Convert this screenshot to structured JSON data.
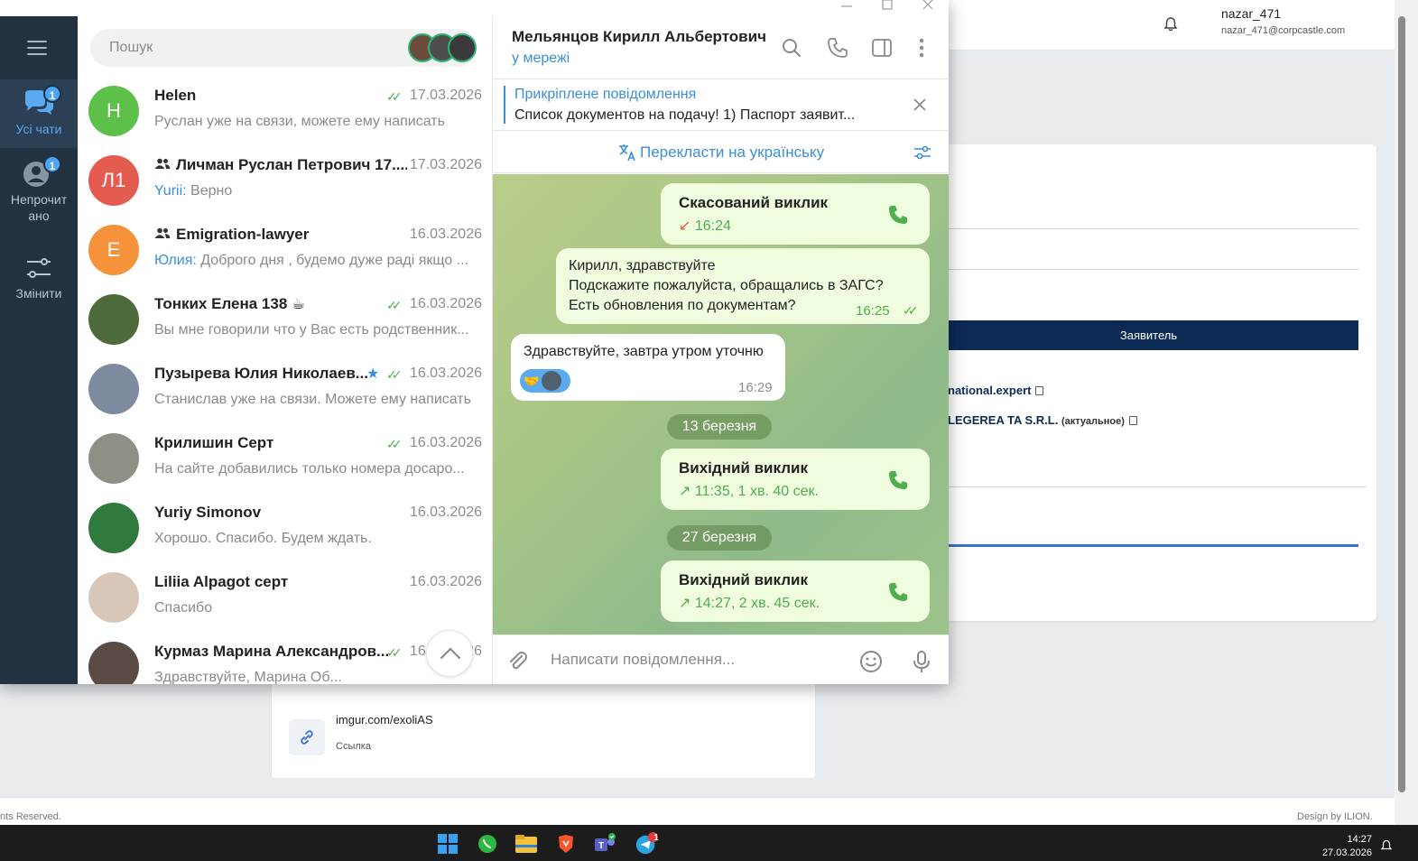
{
  "background_app": {
    "user_name": "nazar_471",
    "user_email": "nazar_471@corpcastle.com",
    "applicant_button": "Заявитель",
    "link1": "national.expert",
    "link2_main": "LEGEREA TA S.R.L.",
    "link2_tag": "(актуальное)",
    "link_url": "imgur.com/exoliAS",
    "link_caption": "Ссылка",
    "footer_left": "nts Reserved.",
    "footer_right": "Design by ILION."
  },
  "taskbar": {
    "time": "14:27",
    "date": "27.03.2026",
    "telegram_badge": "1"
  },
  "telegram": {
    "rail": {
      "all_chats_label": "Усі чати",
      "all_chats_badge": "1",
      "unread_label_1": "Непрочит",
      "unread_label_2": "ано",
      "unread_badge": "1",
      "edit_label": "Змінити"
    },
    "search_placeholder": "Пошук",
    "chats": [
      {
        "initials": "H",
        "name": "Helen",
        "date": "17.03.2026",
        "sender": "",
        "message": "Руслан уже на связи, можете ему написать",
        "color": "#5cc04b"
      },
      {
        "initials": "Л1",
        "name": "Личман Руслан Петрович 17....",
        "date": "17.03.2026",
        "sender": "Yurii:",
        "message": " Верно",
        "color": "#e45b4f"
      },
      {
        "initials": "E",
        "name": "Emigration-lawyer",
        "date": "16.03.2026",
        "sender": "Юлия:",
        "message": " Доброго дня , будемо дуже раді якщо ...",
        "color": "#f6923a"
      },
      {
        "initials": "",
        "name": "Тонких Елена 138 ☕",
        "date": "16.03.2026",
        "sender": "",
        "message": "Вы мне говорили что у Вас есть родственник...",
        "color": "#4d6b3a"
      },
      {
        "initials": "",
        "name": "Пузырева Юлия Николаев...",
        "date": "16.03.2026",
        "sender": "",
        "message": "Станислав уже на связи. Можете ему написать",
        "color": "#7d8aa0"
      },
      {
        "initials": "",
        "name": "Крилишин Серт",
        "date": "16.03.2026",
        "sender": "",
        "message": "На сайте добавились только номера досаро...",
        "color": "#8f8f86"
      },
      {
        "initials": "",
        "name": "Yuriy Simonov",
        "date": "16.03.2026",
        "sender": "",
        "message": "Хорошо. Спасибо. Будем ждать.",
        "color": "#2f7a3c"
      },
      {
        "initials": "",
        "name": "Liliia Alpagot серт",
        "date": "16.03.2026",
        "sender": "",
        "message": "Спасибо",
        "color": "#d8c7b8"
      },
      {
        "initials": "",
        "name": "Курмаз Марина Александров...",
        "date": "16.03.2026",
        "sender": "",
        "message": "Здравствуйте, Марина Об...",
        "color": "#5a4b44"
      }
    ],
    "chat": {
      "title": "Мельянцов Кирилл Альбертович",
      "status": "у мережі",
      "pinned_title": "Прикріплене повідомлення",
      "pinned_text": "Список документов на подачу!  1) Паспорт заявит...",
      "translate_label": "Перекласти на українську",
      "messages": {
        "call1_title": "Скасований виклик",
        "call1_meta": "16:24",
        "out_line1": "Кирилл, здравствуйте",
        "out_line2": "Подскажите пожалуйста, обращались в ЗАГС?",
        "out_line3": "Есть обновления по документам?",
        "out_time": "16:25",
        "in_text": "Здравствуйте, завтра утром уточню",
        "in_time": "16:29",
        "date1": "13 березня",
        "call2_title": "Вихідний виклик",
        "call2_meta": "11:35, 1 хв. 40 сек.",
        "date2": "27 березня",
        "call3_title": "Вихідний виклик",
        "call3_meta": "14:27, 2 хв. 45 сек."
      },
      "composer_placeholder": "Написати повідомлення..."
    }
  }
}
